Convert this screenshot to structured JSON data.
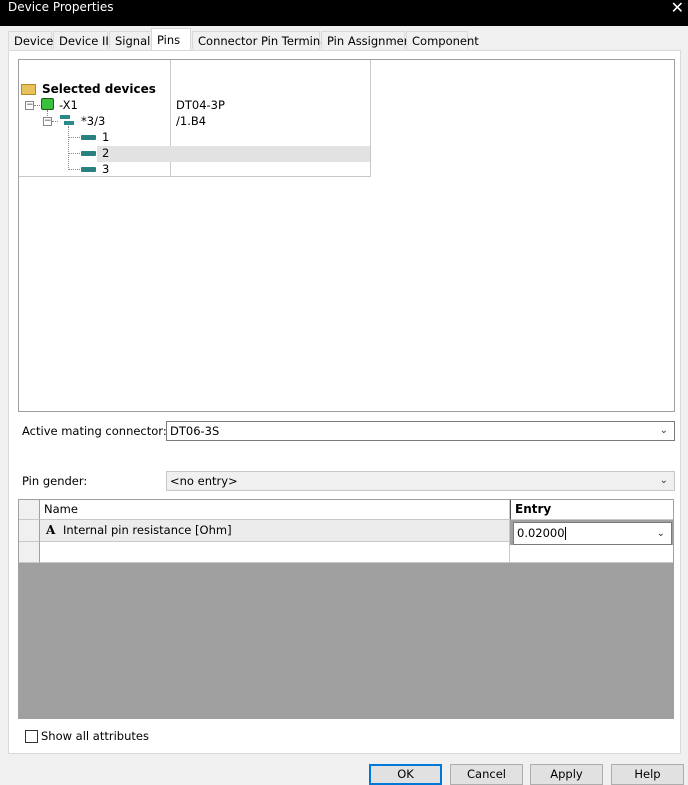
{
  "window": {
    "title": "Device Properties",
    "close_glyph": "✕"
  },
  "tabs": [
    {
      "label": "Device"
    },
    {
      "label": "Device II"
    },
    {
      "label": "Signal"
    },
    {
      "label": "Pins"
    },
    {
      "label": "Connector Pin Terminals"
    },
    {
      "label": "Pin Assignment"
    },
    {
      "label": "Component"
    }
  ],
  "active_tab": "Pins",
  "tree": {
    "root_label": "Selected devices",
    "device": {
      "name": "-X1",
      "value": "DT04-3P"
    },
    "connector": {
      "name": "*3/3",
      "value": "/1.B4"
    },
    "pins": [
      "1",
      "2",
      "3"
    ],
    "selected_pin": "2",
    "icons": {
      "root": "folder-icon",
      "device": "device-icon",
      "connector": "connector-icon",
      "pin": "pin-icon"
    }
  },
  "form": {
    "mating_connector_label": "Active mating connector:",
    "mating_connector_value": "DT06-3S",
    "pin_gender_label": "Pin gender:",
    "pin_gender_value": "<no entry>"
  },
  "attributes": {
    "headers": {
      "name": "Name",
      "entry": "Entry"
    },
    "rows": [
      {
        "type_glyph": "A",
        "name": "Internal pin resistance [Ohm]",
        "entry": "0.02000"
      }
    ]
  },
  "show_all_attributes": {
    "label": "Show all attributes",
    "checked": false
  },
  "buttons": {
    "ok": "OK",
    "cancel": "Cancel",
    "apply": "Apply",
    "help": "Help"
  },
  "colors": {
    "title_bar": "#000000",
    "dialog_bg": "#f0f0f0",
    "grid_empty_bg": "#a0a0a0",
    "default_button_border": "#0078d7"
  }
}
